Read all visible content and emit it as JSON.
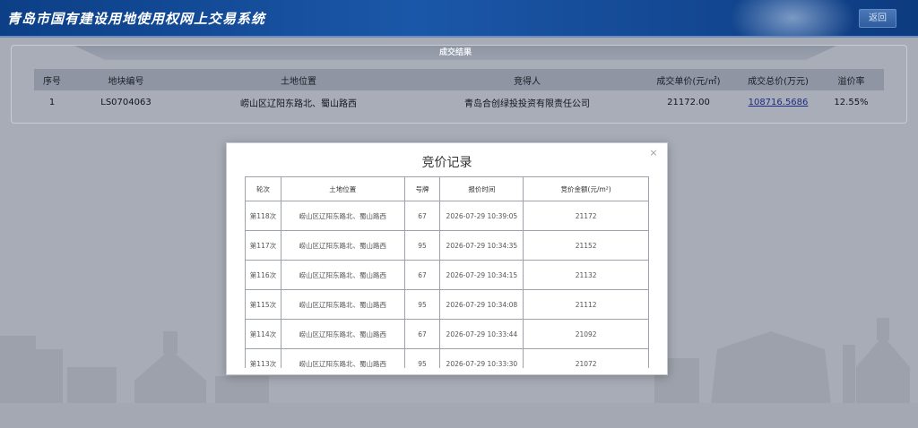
{
  "header": {
    "title": "青岛市国有建设用地使用权网上交易系统",
    "back_label": "返回"
  },
  "result": {
    "tab_label": "成交结果",
    "columns": [
      "序号",
      "地块编号",
      "土地位置",
      "竞得人",
      "成交单价(元/㎡)",
      "成交总价(万元)",
      "溢价率"
    ],
    "rows": [
      {
        "index": "1",
        "parcel_no": "LS0704063",
        "location": "崂山区辽阳东路北、蜀山路西",
        "winner": "青岛合创绿投投资有限责任公司",
        "unit_price": "21172.00",
        "total_price": "108716.5686",
        "premium": "12.55%"
      }
    ]
  },
  "modal": {
    "title": "竞价记录",
    "close_label": "×",
    "columns": [
      "轮次",
      "土地位置",
      "号牌",
      "报价时间",
      "竞价金额(元/m²)"
    ],
    "rows": [
      {
        "round": "第118次",
        "location": "崂山区辽阳东路北、蜀山路西",
        "paddle": "67",
        "time": "2026-07-29 10:39:05",
        "amount": "21172"
      },
      {
        "round": "第117次",
        "location": "崂山区辽阳东路北、蜀山路西",
        "paddle": "95",
        "time": "2026-07-29 10:34:35",
        "amount": "21152"
      },
      {
        "round": "第116次",
        "location": "崂山区辽阳东路北、蜀山路西",
        "paddle": "67",
        "time": "2026-07-29 10:34:15",
        "amount": "21132"
      },
      {
        "round": "第115次",
        "location": "崂山区辽阳东路北、蜀山路西",
        "paddle": "95",
        "time": "2026-07-29 10:34:08",
        "amount": "21112"
      },
      {
        "round": "第114次",
        "location": "崂山区辽阳东路北、蜀山路西",
        "paddle": "67",
        "time": "2026-07-29 10:33:44",
        "amount": "21092"
      },
      {
        "round": "第113次",
        "location": "崂山区辽阳东路北、蜀山路西",
        "paddle": "95",
        "time": "2026-07-29 10:33:30",
        "amount": "21072"
      }
    ]
  }
}
